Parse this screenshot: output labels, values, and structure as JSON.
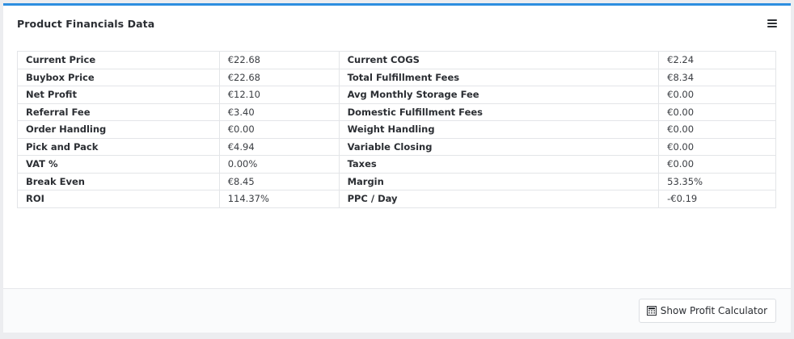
{
  "panel": {
    "title": "Product Financials Data",
    "calculator_button_label": "Show Profit Calculator"
  },
  "icons": {
    "menu": "hamburger-menu-icon",
    "calculator": "calculator-icon"
  },
  "colors": {
    "accent": "#2d8ee0"
  },
  "rows": [
    {
      "label1": "Current Price",
      "value1": "€22.68",
      "label2": "Current COGS",
      "value2": "€2.24"
    },
    {
      "label1": "Buybox Price",
      "value1": "€22.68",
      "label2": "Total Fulfillment Fees",
      "value2": "€8.34"
    },
    {
      "label1": "Net Profit",
      "value1": "€12.10",
      "label2": "Avg Monthly Storage Fee",
      "value2": "€0.00"
    },
    {
      "label1": "Referral Fee",
      "value1": "€3.40",
      "label2": "Domestic Fulfillment Fees",
      "value2": "€0.00"
    },
    {
      "label1": "Order Handling",
      "value1": "€0.00",
      "label2": "Weight Handling",
      "value2": "€0.00"
    },
    {
      "label1": "Pick and Pack",
      "value1": "€4.94",
      "label2": "Variable Closing",
      "value2": "€0.00"
    },
    {
      "label1": "VAT %",
      "value1": "0.00%",
      "label2": "Taxes",
      "value2": "€0.00"
    },
    {
      "label1": "Break Even",
      "value1": "€8.45",
      "label2": "Margin",
      "value2": "53.35%"
    },
    {
      "label1": "ROI",
      "value1": "114.37%",
      "label2": "PPC / Day",
      "value2": "-€0.19"
    }
  ]
}
